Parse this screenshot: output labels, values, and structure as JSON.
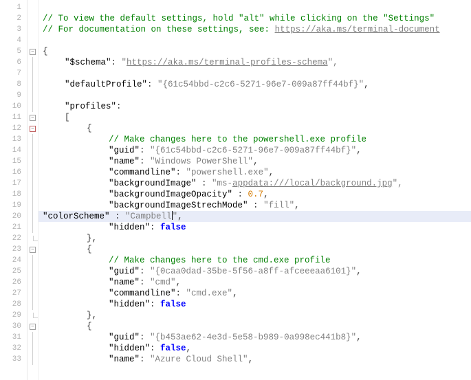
{
  "editor": {
    "highlighted_line": 20,
    "visible_line_start": 1,
    "visible_line_end": 33,
    "lines": {
      "l2": {
        "type": "comment",
        "text": "// To view the default settings, hold \"alt\" while clicking on the \"Settings\""
      },
      "l3": {
        "type": "comment",
        "prefix": "// For documentation on these settings, see: ",
        "url": "https://aka.ms/terminal-document"
      },
      "l5": {
        "type": "punc",
        "text": "{"
      },
      "l6": {
        "key": "\"$schema\"",
        "colon": ": ",
        "val_open": "\"",
        "url": "https://aka.ms/terminal-profiles-schema",
        "val_close": "\","
      },
      "l8": {
        "key": "\"defaultProfile\"",
        "colon": ": ",
        "val": "\"{61c54bbd-c2c6-5271-96e7-009a87ff44bf}\"",
        "trail": ","
      },
      "l10": {
        "key": "\"profiles\"",
        "trail": ":"
      },
      "l11": {
        "text": "["
      },
      "l12": {
        "text": "{"
      },
      "l13": {
        "type": "comment",
        "text": "// Make changes here to the powershell.exe profile"
      },
      "l14": {
        "key": "\"guid\"",
        "colon": ": ",
        "val": "\"{61c54bbd-c2c6-5271-96e7-009a87ff44bf}\"",
        "trail": ","
      },
      "l15": {
        "key": "\"name\"",
        "colon": ": ",
        "val": "\"Windows PowerShell\"",
        "trail": ","
      },
      "l16": {
        "key": "\"commandline\"",
        "colon": ": ",
        "val": "\"powershell.exe\"",
        "trail": ","
      },
      "l17": {
        "key": "\"backgroundImage\"",
        "colon": " : ",
        "val_open": "\"ms-",
        "url": "appdata:///local/background.jpg",
        "val_close": "\","
      },
      "l18": {
        "key": "\"backgroundImageOpacity\"",
        "colon": " : ",
        "num": "0.7",
        "trail": ","
      },
      "l19": {
        "key": "\"backgroundImageStrechMode\"",
        "colon": " : ",
        "val": "\"fill\"",
        "trail": ","
      },
      "l20": {
        "key": "\"colorScheme\"",
        "colon": " : ",
        "val_open": "\"Campbell",
        "val_close": "\"",
        "trail": ","
      },
      "l21": {
        "key": "\"hidden\"",
        "colon": ": ",
        "bool": "false"
      },
      "l22": {
        "text": "},"
      },
      "l23": {
        "text": "{"
      },
      "l24": {
        "type": "comment",
        "text": "// Make changes here to the cmd.exe profile"
      },
      "l25": {
        "key": "\"guid\"",
        "colon": ": ",
        "val": "\"{0caa0dad-35be-5f56-a8ff-afceeeaa6101}\"",
        "trail": ","
      },
      "l26": {
        "key": "\"name\"",
        "colon": ": ",
        "val": "\"cmd\"",
        "trail": ","
      },
      "l27": {
        "key": "\"commandline\"",
        "colon": ": ",
        "val": "\"cmd.exe\"",
        "trail": ","
      },
      "l28": {
        "key": "\"hidden\"",
        "colon": ": ",
        "bool": "false"
      },
      "l29": {
        "text": "},"
      },
      "l30": {
        "text": "{"
      },
      "l31": {
        "key": "\"guid\"",
        "colon": ": ",
        "val": "\"{b453ae62-4e3d-5e58-b989-0a998ec441b8}\"",
        "trail": ","
      },
      "l32": {
        "key": "\"hidden\"",
        "colon": ": ",
        "bool": "false",
        "trail": ","
      },
      "l33": {
        "key": "\"name\"",
        "colon": ": ",
        "val": "\"Azure Cloud Shell\"",
        "trail": ","
      }
    }
  },
  "fold_markers": {
    "minus": "−"
  }
}
